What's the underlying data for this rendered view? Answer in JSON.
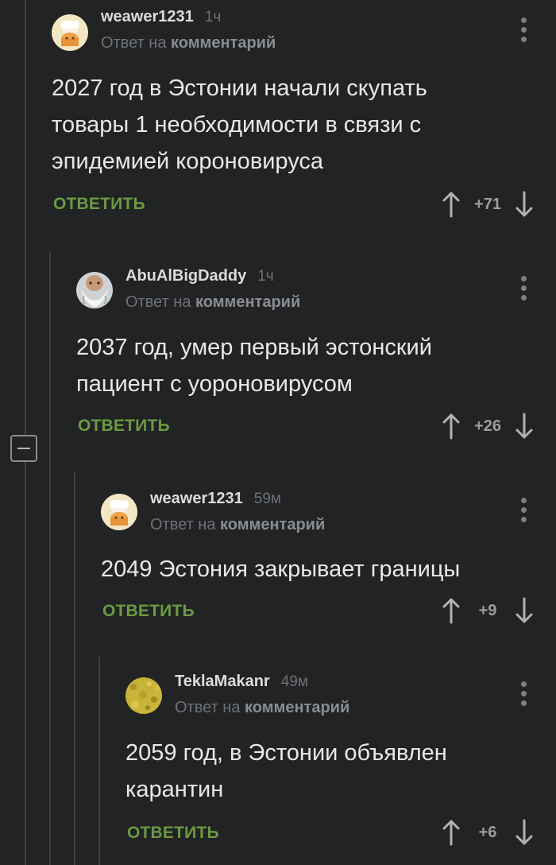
{
  "comments": [
    {
      "username": "weawer1231",
      "time": "1ч",
      "reply_prefix": "Ответ на",
      "reply_target": "комментарий",
      "lines": [
        "2027 год в Эстонии начали скупать",
        "товары 1 необходимости в связи с",
        "эпидемией короновируса"
      ],
      "reply_label": "ОТВЕТИТЬ",
      "score": "+71",
      "avatar_icon": "chef-cake-avatar"
    },
    {
      "username": "AbuAlBigDaddy",
      "time": "1ч",
      "reply_prefix": "Ответ на",
      "reply_target": "комментарий",
      "lines": [
        "2037 год, умер первый эстонский",
        "пациент с уороновирусом"
      ],
      "reply_label": "ОТВЕТИТЬ",
      "score": "+26",
      "avatar_icon": "bearded-man-avatar"
    },
    {
      "username": "weawer1231",
      "time": "59м",
      "reply_prefix": "Ответ на",
      "reply_target": "комментарий",
      "lines": [
        "2049 Эстония закрывает границы"
      ],
      "reply_label": "ОТВЕТИТЬ",
      "score": "+9",
      "avatar_icon": "chef-cake-avatar"
    },
    {
      "username": "TeklaMakanr",
      "time": "49м",
      "reply_prefix": "Ответ на",
      "reply_target": "комментарий",
      "lines": [
        "2059 год, в Эстонии объявлен",
        "карантин"
      ],
      "reply_label": "ОТВЕТИТЬ",
      "score": "+6",
      "avatar_icon": "yellow-texture-avatar"
    }
  ],
  "colors": {
    "background": "#212325",
    "reply_green": "#6b9a42",
    "muted": "#6f7275",
    "thread_line": "#3d4043"
  },
  "icons": {
    "upvote": "arrow-up-icon",
    "downvote": "arrow-down-icon",
    "more": "more-vertical-icon",
    "collapse": "minus-icon"
  }
}
